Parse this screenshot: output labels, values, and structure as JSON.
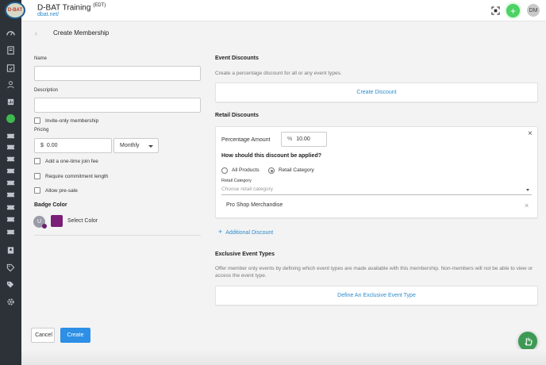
{
  "app": {
    "title": "D-BAT Training",
    "title_sup": "(EDT)",
    "subtitle": "dbat.net/",
    "user_initials": "DM",
    "logo_text": "D-BAT"
  },
  "page": {
    "title": "Create Membership"
  },
  "form": {
    "name_label": "Name",
    "name_value": "",
    "description_label": "Description",
    "description_value": "",
    "invite_only_label": "Invite-only membership",
    "pricing_label": "Pricing",
    "currency": "$",
    "price_value": "0.00",
    "period": "Monthly",
    "join_fee_label": "Add a one-time join fee",
    "commitment_label": "Require commitment length",
    "presale_label": "Allow pre-sale",
    "badge_color_label": "Badge Color",
    "badge_initial": "U",
    "badge_color": "#7a1e78",
    "select_color_label": "Select Color",
    "cancel_label": "Cancel",
    "create_label": "Create"
  },
  "event_discounts": {
    "title": "Event Discounts",
    "description": "Create a percentage discount for all or any event types.",
    "button_label": "Create Discount"
  },
  "retail_discounts": {
    "title": "Retail Discounts",
    "percentage_label": "Percentage Amount",
    "percent_symbol": "%",
    "percentage_value": "10.00",
    "question": "How should this discount be applied?",
    "options": [
      "All Products",
      "Retail Category"
    ],
    "selected_option": "Retail Category",
    "category_label": "Retail Category",
    "category_placeholder": "Choose retail category",
    "selected_category": "Pro Shop Merchandise",
    "add_label": "Additional Discount"
  },
  "exclusive_events": {
    "title": "Exclusive Event Types",
    "description": "Offer member only events by defining which event types are made available with this membership. Non-members will not be able to view or access the event type.",
    "button_label": "Define An Exclusive Event Type"
  },
  "colors": {
    "accent": "#2d8ccc",
    "primary_button": "#2d8fe5",
    "add_button": "#4cd264",
    "sidebar": "#2c3238",
    "fab": "#3d9a54"
  },
  "icons": {
    "sidebar": [
      "dashboard-icon",
      "book-icon",
      "calendar-check-icon",
      "users-icon",
      "report-icon",
      "active-circle-icon",
      "ticket-icon",
      "ticket-icon",
      "ticket-icon",
      "ticket-icon",
      "ticket-icon",
      "ticket-icon",
      "ticket-icon",
      "ticket-icon",
      "contact-card-icon",
      "tag-icon",
      "tags-icon",
      "gear-icon"
    ]
  }
}
